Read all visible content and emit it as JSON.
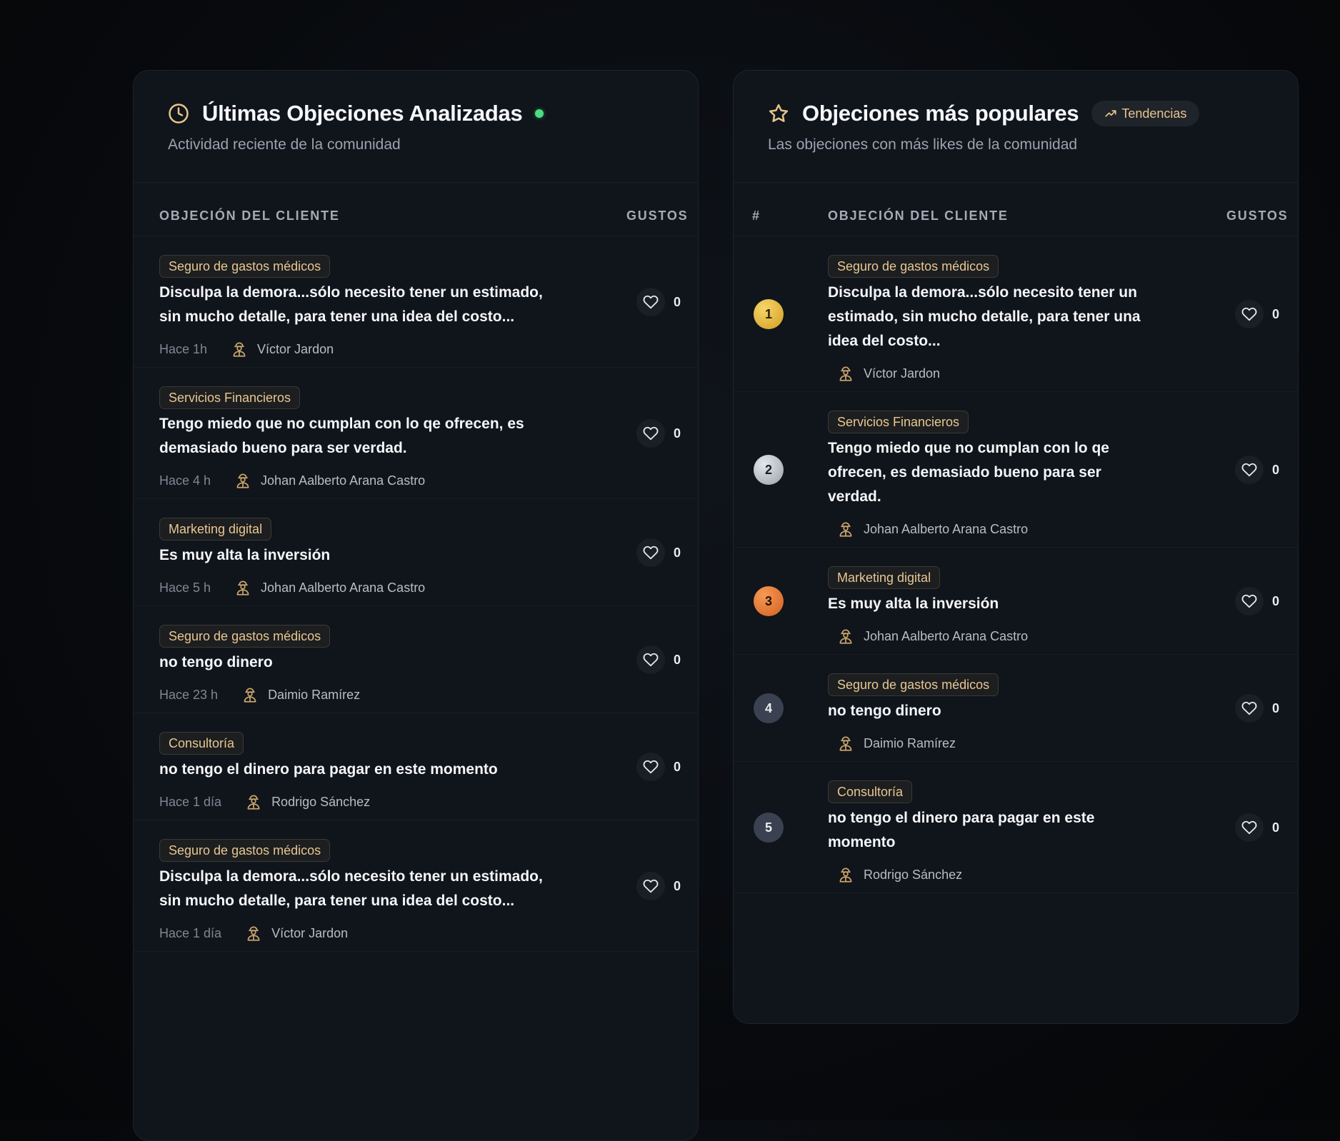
{
  "recent": {
    "title": "Últimas Objeciones Analizadas",
    "subtitle": "Actividad reciente de la comunidad",
    "columns": {
      "objection": "OBJECIÓN DEL CLIENTE",
      "likes": "GUSTOS"
    },
    "items": [
      {
        "tag": "Seguro de gastos médicos",
        "lines": [
          "Disculpa la demora...sólo necesito tener un estimado,",
          "sin mucho detalle, para tener una idea del costo..."
        ],
        "time": "Hace 1h",
        "author": "Víctor Jardon",
        "likes": "0"
      },
      {
        "tag": "Servicios Financieros",
        "lines": [
          "Tengo miedo que no cumplan con lo qe ofrecen, es",
          "demasiado bueno para ser verdad."
        ],
        "time": "Hace 4 h",
        "author": "Johan Aalberto Arana Castro",
        "likes": "0"
      },
      {
        "tag": "Marketing digital",
        "lines": [
          "Es muy alta la inversión"
        ],
        "time": "Hace 5 h",
        "author": "Johan Aalberto Arana Castro",
        "likes": "0"
      },
      {
        "tag": "Seguro de gastos médicos",
        "lines": [
          "no tengo dinero"
        ],
        "time": "Hace 23 h",
        "author": "Daimio Ramírez",
        "likes": "0"
      },
      {
        "tag": "Consultoría",
        "lines": [
          "no tengo el dinero para pagar en este momento"
        ],
        "time": "Hace 1 día",
        "author": "Rodrigo Sánchez",
        "likes": "0"
      },
      {
        "tag": "Seguro de gastos médicos",
        "lines": [
          "Disculpa la demora...sólo necesito tener un estimado,",
          "sin mucho detalle, para tener una idea del costo..."
        ],
        "time": "Hace 1 día",
        "author": "Víctor Jardon",
        "likes": "0"
      }
    ]
  },
  "popular": {
    "title": "Objeciones más populares",
    "badge": "Tendencias",
    "subtitle": "Las objeciones con más likes de la comunidad",
    "columns": {
      "rank": "#",
      "objection": "OBJECIÓN DEL CLIENTE",
      "likes": "GUSTOS"
    },
    "items": [
      {
        "rank": "1",
        "tag": "Seguro de gastos médicos",
        "lines": [
          "Disculpa la demora...sólo necesito tener un",
          "estimado, sin mucho detalle, para tener una",
          "idea del costo..."
        ],
        "author": "Víctor Jardon",
        "likes": "0"
      },
      {
        "rank": "2",
        "tag": "Servicios Financieros",
        "lines": [
          "Tengo miedo que no cumplan con lo qe",
          "ofrecen, es demasiado bueno para ser",
          "verdad."
        ],
        "author": "Johan Aalberto Arana Castro",
        "likes": "0"
      },
      {
        "rank": "3",
        "tag": "Marketing digital",
        "lines": [
          "Es muy alta la inversión"
        ],
        "author": "Johan Aalberto Arana Castro",
        "likes": "0"
      },
      {
        "rank": "4",
        "tag": "Seguro de gastos médicos",
        "lines": [
          "no tengo dinero"
        ],
        "author": "Daimio Ramírez",
        "likes": "0"
      },
      {
        "rank": "5",
        "tag": "Consultoría",
        "lines": [
          "no tengo el dinero para pagar en este",
          "momento"
        ],
        "author": "Rodrigo Sánchez",
        "likes": "0"
      }
    ]
  },
  "icons": {
    "recent_header": "clock-icon",
    "popular_header": "star-icon",
    "badge": "trending-up-icon",
    "like": "heart-icon",
    "author": "user-avatar-icon"
  },
  "colors": {
    "accent_gold": "#e8c791",
    "live_dot": "#4ade80",
    "rank_gold": "#e0b03a",
    "rank_silver": "#c4c9d0",
    "rank_bronze": "#ea7a35",
    "rank_default": "#3a4150"
  }
}
